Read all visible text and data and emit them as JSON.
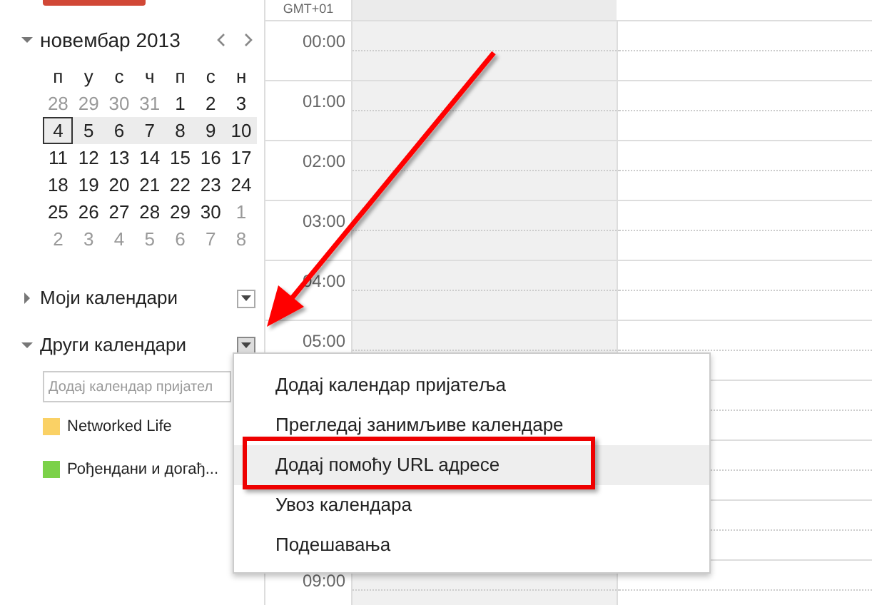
{
  "mini_calendar": {
    "title": "новембар 2013",
    "expanded": true,
    "weekdays": [
      "п",
      "у",
      "с",
      "ч",
      "п",
      "с",
      "н"
    ],
    "weeks": [
      {
        "current": false,
        "days": [
          {
            "text": "28",
            "muted": true,
            "selected": false
          },
          {
            "text": "29",
            "muted": true,
            "selected": false
          },
          {
            "text": "30",
            "muted": true,
            "selected": false
          },
          {
            "text": "31",
            "muted": true,
            "selected": false
          },
          {
            "text": "1",
            "muted": false,
            "selected": false
          },
          {
            "text": "2",
            "muted": false,
            "selected": false
          },
          {
            "text": "3",
            "muted": false,
            "selected": false
          }
        ]
      },
      {
        "current": true,
        "days": [
          {
            "text": "4",
            "muted": false,
            "selected": true
          },
          {
            "text": "5",
            "muted": false,
            "selected": false
          },
          {
            "text": "6",
            "muted": false,
            "selected": false
          },
          {
            "text": "7",
            "muted": false,
            "selected": false
          },
          {
            "text": "8",
            "muted": false,
            "selected": false
          },
          {
            "text": "9",
            "muted": false,
            "selected": false
          },
          {
            "text": "10",
            "muted": false,
            "selected": false
          }
        ]
      },
      {
        "current": false,
        "days": [
          {
            "text": "11",
            "muted": false,
            "selected": false
          },
          {
            "text": "12",
            "muted": false,
            "selected": false
          },
          {
            "text": "13",
            "muted": false,
            "selected": false
          },
          {
            "text": "14",
            "muted": false,
            "selected": false
          },
          {
            "text": "15",
            "muted": false,
            "selected": false
          },
          {
            "text": "16",
            "muted": false,
            "selected": false
          },
          {
            "text": "17",
            "muted": false,
            "selected": false
          }
        ]
      },
      {
        "current": false,
        "days": [
          {
            "text": "18",
            "muted": false,
            "selected": false
          },
          {
            "text": "19",
            "muted": false,
            "selected": false
          },
          {
            "text": "20",
            "muted": false,
            "selected": false
          },
          {
            "text": "21",
            "muted": false,
            "selected": false
          },
          {
            "text": "22",
            "muted": false,
            "selected": false
          },
          {
            "text": "23",
            "muted": false,
            "selected": false
          },
          {
            "text": "24",
            "muted": false,
            "selected": false
          }
        ]
      },
      {
        "current": false,
        "days": [
          {
            "text": "25",
            "muted": false,
            "selected": false
          },
          {
            "text": "26",
            "muted": false,
            "selected": false
          },
          {
            "text": "27",
            "muted": false,
            "selected": false
          },
          {
            "text": "28",
            "muted": false,
            "selected": false
          },
          {
            "text": "29",
            "muted": false,
            "selected": false
          },
          {
            "text": "30",
            "muted": false,
            "selected": false
          },
          {
            "text": "1",
            "muted": true,
            "selected": false
          }
        ]
      },
      {
        "current": false,
        "days": [
          {
            "text": "2",
            "muted": true,
            "selected": false
          },
          {
            "text": "3",
            "muted": true,
            "selected": false
          },
          {
            "text": "4",
            "muted": true,
            "selected": false
          },
          {
            "text": "5",
            "muted": true,
            "selected": false
          },
          {
            "text": "6",
            "muted": true,
            "selected": false
          },
          {
            "text": "7",
            "muted": true,
            "selected": false
          },
          {
            "text": "8",
            "muted": true,
            "selected": false
          }
        ]
      }
    ]
  },
  "sections": [
    {
      "title": "Моји календари",
      "expanded": false,
      "menu_open": false
    },
    {
      "title": "Други календари",
      "expanded": true,
      "menu_open": true,
      "add_field": {
        "placeholder": "Додај календар пријател"
      },
      "calendars": [
        {
          "name": "Networked Life",
          "color": "#fad165"
        },
        {
          "name": "Рођендани и догађ...",
          "color": "#7bd148"
        }
      ]
    }
  ],
  "timezone": "GMT+01",
  "hours": [
    "00:00",
    "01:00",
    "02:00",
    "03:00",
    "04:00",
    "05:00",
    "09:00"
  ],
  "context_menu": {
    "items": [
      {
        "label": "Додај календар пријатеља",
        "selected": false
      },
      {
        "label": "Прегледај занимљиве календаре",
        "selected": false
      },
      {
        "label": "Додај помоћу URL адресе",
        "selected": true
      },
      {
        "label": "Увоз календара",
        "selected": false
      },
      {
        "label": "Подешавања",
        "selected": false
      }
    ]
  },
  "annotations": {
    "arrow": true,
    "highlight": true
  }
}
